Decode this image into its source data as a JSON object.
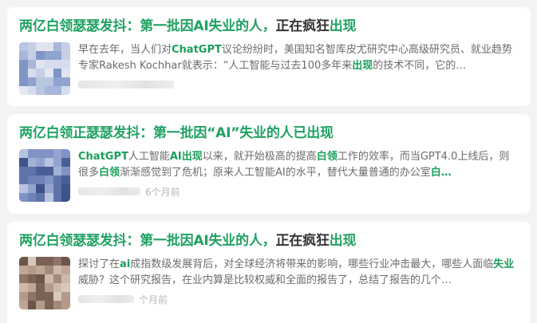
{
  "results": [
    {
      "title_a": "两亿白领瑟瑟发抖：第一批因AI失业的人，",
      "title_b": "正在疯狂",
      "title_c": "出现",
      "desc_parts": [
        {
          "t": "早在去年，当人们对",
          "hl": false
        },
        {
          "t": "ChatGPT",
          "hl": true
        },
        {
          "t": "议论纷纷时，美国知名智库皮尤研究中心高级研究员、就业趋势专家Rakesh Kochhar就表示：“人工智能与过去100多年来",
          "hl": false
        },
        {
          "t": "出现",
          "hl": true
        },
        {
          "t": "的技术不同，它的…",
          "hl": false
        }
      ],
      "time": ""
    },
    {
      "title_a": "两亿白领正瑟瑟发抖：第一批因“AI”失业的人已出现",
      "title_b": "",
      "title_c": "",
      "desc_parts": [
        {
          "t": "ChatGPT",
          "hl": true
        },
        {
          "t": "人工智能",
          "hl": false
        },
        {
          "t": "AI出现",
          "hl": true
        },
        {
          "t": "以来，就开始极高的提高",
          "hl": false
        },
        {
          "t": "白领",
          "hl": true
        },
        {
          "t": "工作的效率，而当GPT4.0上线后，则很多",
          "hl": false
        },
        {
          "t": "白领",
          "hl": true
        },
        {
          "t": "渐渐感觉到了危机；原来人工智能AI的水平，替代大量普通的办公室",
          "hl": false
        },
        {
          "t": "白…",
          "hl": true
        }
      ],
      "time": "6个月前"
    },
    {
      "title_a": "两亿白领瑟瑟发抖：第一批因AI失业的人，",
      "title_b": "正在疯狂",
      "title_c": "出现",
      "desc_parts": [
        {
          "t": "探讨了在",
          "hl": false
        },
        {
          "t": "ai",
          "hl": true
        },
        {
          "t": "成指数级发展背后，对全球经济将带来的影响，哪些行业冲击最大，哪些人面临",
          "hl": false
        },
        {
          "t": "失业",
          "hl": true
        },
        {
          "t": "威胁？这个研究报告，在业内算是比较权威和全面的报告了，总结了报告的几个…",
          "hl": false
        }
      ],
      "time": "个月前"
    }
  ],
  "colors": {
    "accent": "#1a9f59",
    "page_bg": "#f2f3f5",
    "text": "#6b6b6b"
  }
}
